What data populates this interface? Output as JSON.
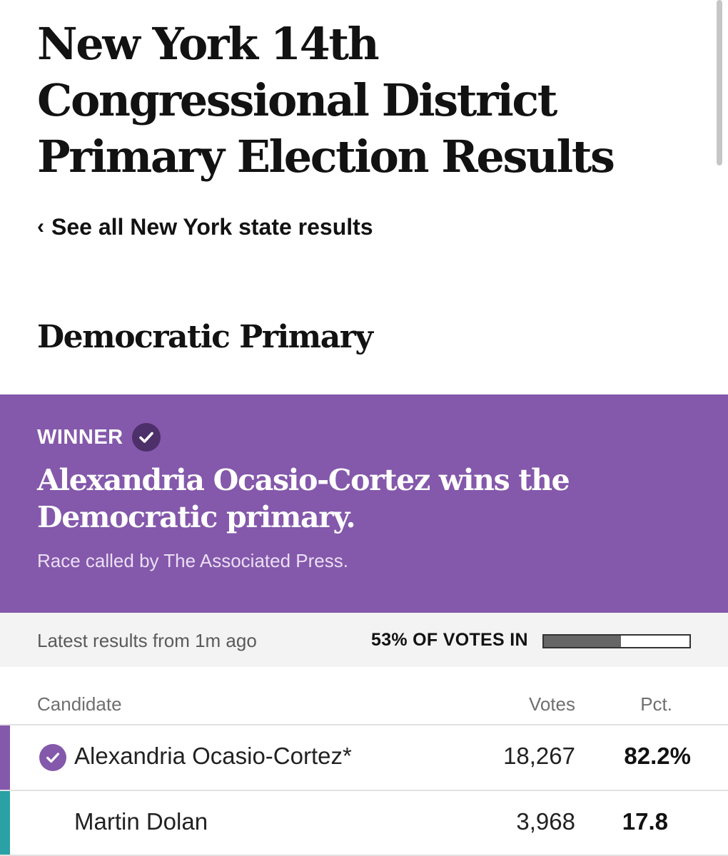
{
  "page": {
    "title": "New York 14th Congressional District Primary Election Results",
    "back_link": "See all New York state results",
    "back_chevron": "‹",
    "section_heading": "Democratic Primary"
  },
  "winner": {
    "label": "WINNER",
    "icon": "checkmark-icon",
    "headline": "Alexandria Ocasio-Cortez wins the Democratic primary.",
    "note": "Race called by The Associated Press.",
    "banner_color": "#8458ab"
  },
  "status": {
    "latest": "Latest results from 1m ago",
    "votes_in_label": "53% OF VOTES IN",
    "votes_in_fraction": 0.53
  },
  "table": {
    "headers": {
      "candidate": "Candidate",
      "votes": "Votes",
      "pct": "Pct."
    },
    "rows": [
      {
        "name": "Alexandria Ocasio-Cortez*",
        "votes": "18,267",
        "pct": "82.2%",
        "winner": true,
        "party_color": "#8458ab"
      },
      {
        "name": "Martin Dolan",
        "votes": "3,968",
        "pct": "17.8",
        "winner": false,
        "party_color": "#2aa1a4"
      }
    ]
  }
}
